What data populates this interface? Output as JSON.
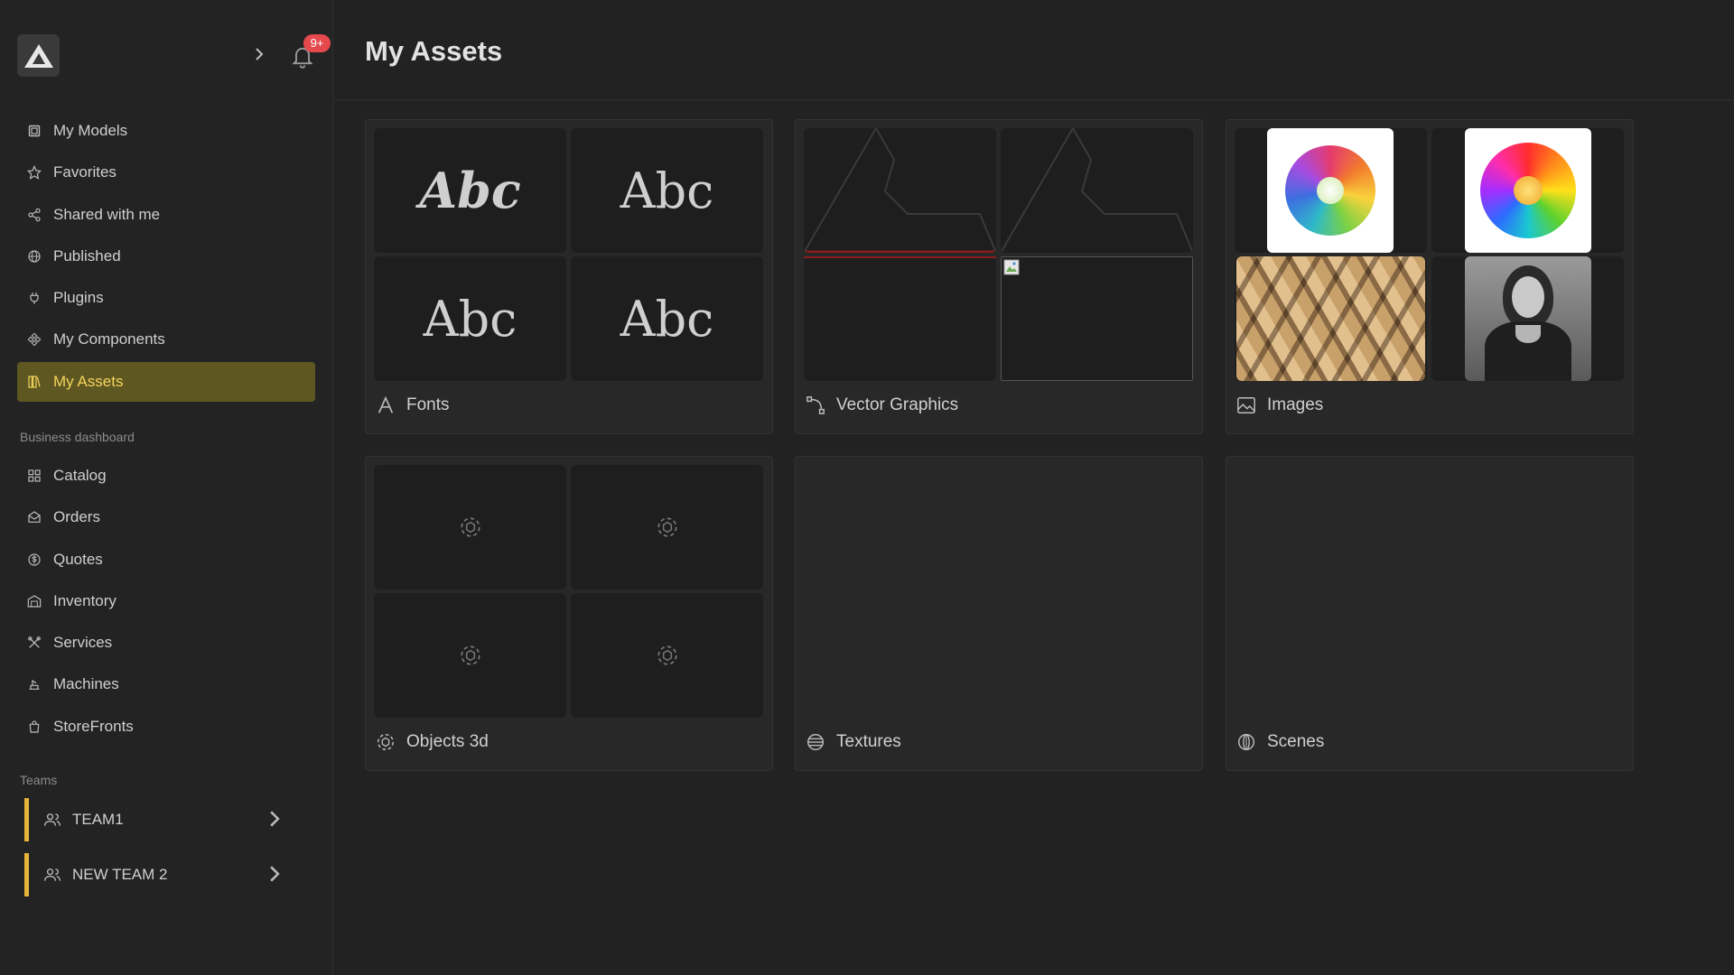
{
  "app": {
    "logo": "app-logo"
  },
  "notifications": {
    "badge": "9+"
  },
  "sidebar": {
    "items": [
      {
        "label": "My Models",
        "icon": "cube-icon"
      },
      {
        "label": "Favorites",
        "icon": "star-icon"
      },
      {
        "label": "Shared with me",
        "icon": "share-icon"
      },
      {
        "label": "Published",
        "icon": "globe-icon"
      },
      {
        "label": "Plugins",
        "icon": "plug-icon"
      },
      {
        "label": "My Components",
        "icon": "components-icon"
      },
      {
        "label": "My Assets",
        "icon": "assets-icon",
        "active": true
      }
    ],
    "business_label": "Business dashboard",
    "business_items": [
      {
        "label": "Catalog",
        "icon": "grid-icon"
      },
      {
        "label": "Orders",
        "icon": "orders-icon"
      },
      {
        "label": "Quotes",
        "icon": "dollar-icon"
      },
      {
        "label": "Inventory",
        "icon": "warehouse-icon"
      },
      {
        "label": "Services",
        "icon": "tools-icon"
      },
      {
        "label": "Machines",
        "icon": "machine-icon"
      },
      {
        "label": "StoreFronts",
        "icon": "bag-icon"
      }
    ],
    "teams_label": "Teams",
    "teams": [
      {
        "label": "TEAM1",
        "icon": "users-icon"
      },
      {
        "label": "NEW TEAM 2",
        "icon": "users-icon"
      }
    ]
  },
  "header": {
    "title": "My Assets"
  },
  "cards": {
    "fonts": {
      "label": "Fonts",
      "samples": [
        "Abc",
        "Abc",
        "Abc",
        "Abc"
      ]
    },
    "vector": {
      "label": "Vector Graphics"
    },
    "images": {
      "label": "Images"
    },
    "objects": {
      "label": "Objects 3d"
    },
    "textures": {
      "label": "Textures"
    },
    "scenes": {
      "label": "Scenes"
    }
  },
  "colors": {
    "accent": "#e8b33a",
    "active_bg": "#5f5722",
    "active_text": "#f2d55b",
    "badge": "#e5484d"
  }
}
